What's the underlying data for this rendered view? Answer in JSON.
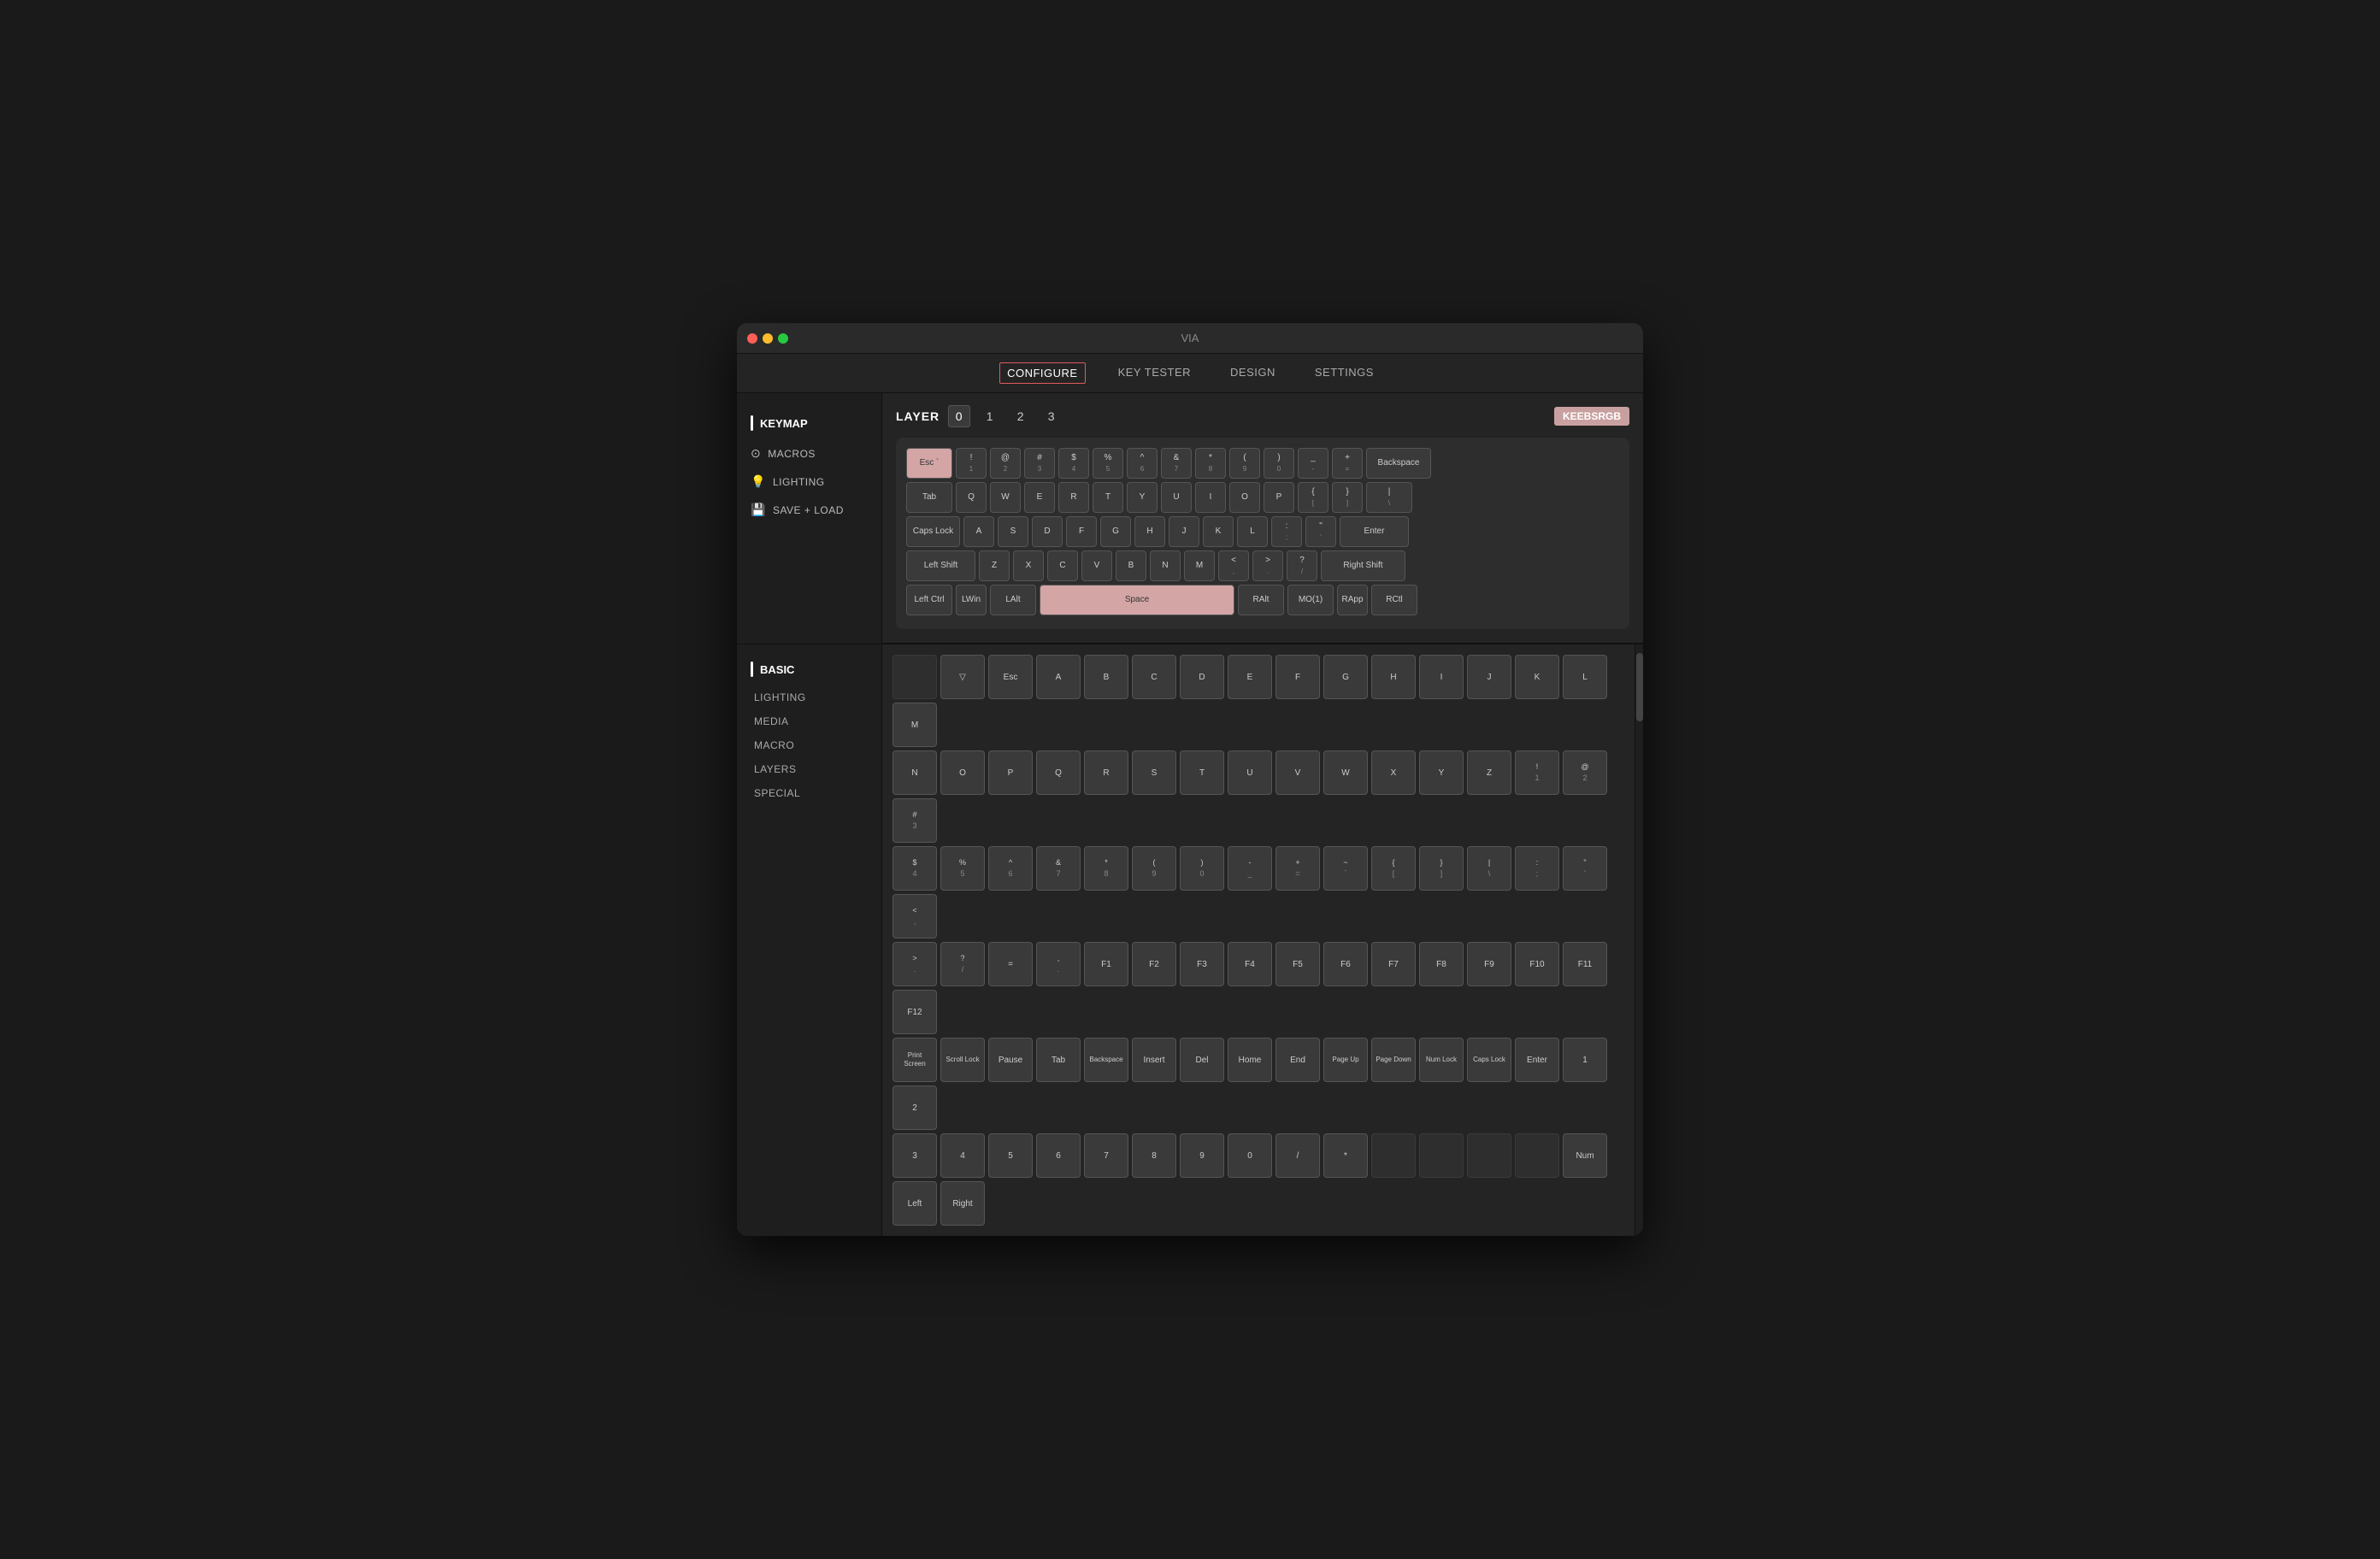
{
  "window": {
    "title": "VIA"
  },
  "nav": {
    "items": [
      {
        "id": "configure",
        "label": "CONFIGURE",
        "active": true
      },
      {
        "id": "key-tester",
        "label": "KEY TESTER",
        "active": false
      },
      {
        "id": "design",
        "label": "DESIGN",
        "active": false
      },
      {
        "id": "settings",
        "label": "SETTINGS",
        "active": false
      }
    ]
  },
  "sidebar": {
    "keymap_label": "KEYMAP",
    "macros_label": "MACROS",
    "lighting_label": "LIGHTING",
    "save_load_label": "SAVE + LOAD"
  },
  "layer": {
    "label": "LAYER",
    "buttons": [
      "0",
      "1",
      "2",
      "3"
    ],
    "active": 0
  },
  "badge": {
    "label": "KEEBSRGB"
  },
  "keyboard_rows": [
    [
      "Esc",
      "! 1",
      "@ 2",
      "# 3",
      "$ 4",
      "% 5",
      "^ 6",
      "& 7",
      "* 8",
      "( 9",
      ") 0",
      "_ -",
      "+ =",
      "Backspace"
    ],
    [
      "Tab",
      "Q",
      "W",
      "E",
      "R",
      "T",
      "Y",
      "U",
      "I",
      "O",
      "P",
      "{ [",
      "} ]",
      "| \\"
    ],
    [
      "Caps Lock",
      "A",
      "S",
      "D",
      "F",
      "G",
      "H",
      "J",
      "K",
      "L",
      ": ;",
      "\" '",
      "Enter"
    ],
    [
      "Left Shift",
      "Z",
      "X",
      "C",
      "V",
      "B",
      "N",
      "M",
      "< ,",
      "> .",
      "? /",
      "Right Shift"
    ],
    [
      "Left Ctrl",
      "LWin",
      "LAlt",
      "Space",
      "RAlt",
      "MO(1)",
      "RApp",
      "RCtl"
    ]
  ],
  "bottom_sidebar": {
    "section_label": "BASIC",
    "items": [
      "LIGHTING",
      "MEDIA",
      "MACRO",
      "LAYERS",
      "SPECIAL"
    ]
  },
  "picker_keys": [
    [
      "",
      "▽",
      "Esc",
      "A",
      "B",
      "C",
      "D",
      "E",
      "F",
      "G",
      "H",
      "I",
      "J",
      "K",
      "L",
      "M"
    ],
    [
      "N",
      "O",
      "P",
      "Q",
      "R",
      "S",
      "T",
      "U",
      "V",
      "W",
      "X",
      "Y",
      "Z",
      "! 1",
      "@ 2",
      "# 3"
    ],
    [
      "$ 4",
      "% 5",
      "^ 6",
      "& 7",
      "* 8",
      "( 9",
      ") 0",
      "- _",
      "+ =",
      "~ `",
      "{ [",
      "} ]",
      "| \\",
      ": ;",
      "\" '",
      "< ,"
    ],
    [
      "> .",
      "? /",
      "=",
      ", .",
      "F1",
      "F2",
      "F3",
      "F4",
      "F5",
      "F6",
      "F7",
      "F8",
      "F9",
      "F10",
      "F11",
      "F12"
    ],
    [
      "Print Screen",
      "Scroll Lock",
      "Pause",
      "Tab",
      "Backspace",
      "Insert",
      "Del",
      "Home",
      "End",
      "Page Up",
      "Page Down",
      "Num Lock",
      "Caps Lock",
      "Enter",
      "1",
      "2"
    ],
    [
      "3",
      "4",
      "5",
      "6",
      "7",
      "8",
      "9",
      "0",
      "/",
      "*",
      "",
      "",
      "",
      "",
      "Num",
      "Left",
      "Right"
    ]
  ]
}
